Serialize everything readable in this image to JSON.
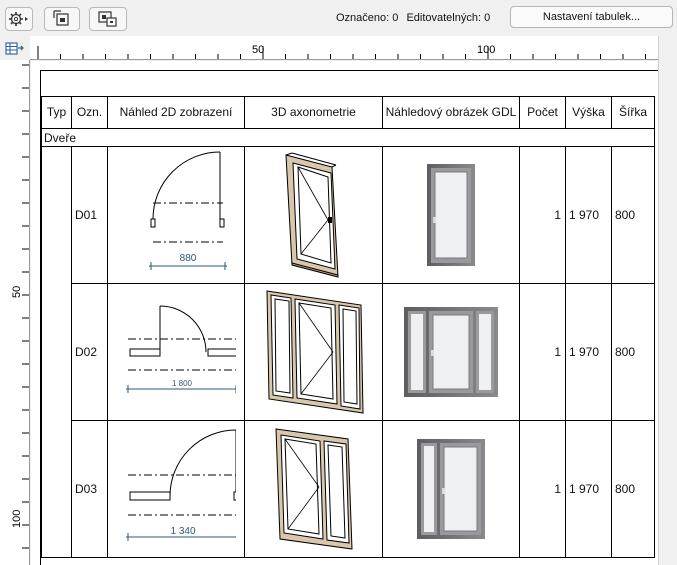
{
  "status": {
    "selected_label": "Označeno: 0",
    "editable_label": "Editovatelných: 0"
  },
  "toolbar": {
    "settings_button_label": "Nastavení tabulek...",
    "icons": [
      "gear-dropdown-icon",
      "fit-window-icon",
      "zoom-selection-icon",
      "schedule-options-icon"
    ]
  },
  "rulers": {
    "top_labels": [
      "50",
      "100"
    ],
    "left_labels": [
      "50",
      "100"
    ]
  },
  "schedule": {
    "columns": [
      "Typ",
      "Ozn.",
      "Náhled 2D zobrazení",
      "3D axonometrie",
      "Náhledový obrázek GDL",
      "Počet",
      "Výška",
      "Šířka"
    ],
    "group_label": "Dveře",
    "rows": [
      {
        "id": "D01",
        "count": "1",
        "height": "1 970",
        "width": "800",
        "dimension_label": "880",
        "kind": "single"
      },
      {
        "id": "D02",
        "count": "1",
        "height": "1 970",
        "width": "800",
        "dimension_label": "1 800",
        "kind": "sidelights"
      },
      {
        "id": "D03",
        "count": "1",
        "height": "1 970",
        "width": "800",
        "dimension_label": "1 340",
        "kind": "double"
      }
    ]
  },
  "colors": {
    "dimension": "#2e5878",
    "frame_wood": "#d9c7ab",
    "gdl_frame": "#6c6c70",
    "gdl_glass": "#f1f2f3"
  }
}
